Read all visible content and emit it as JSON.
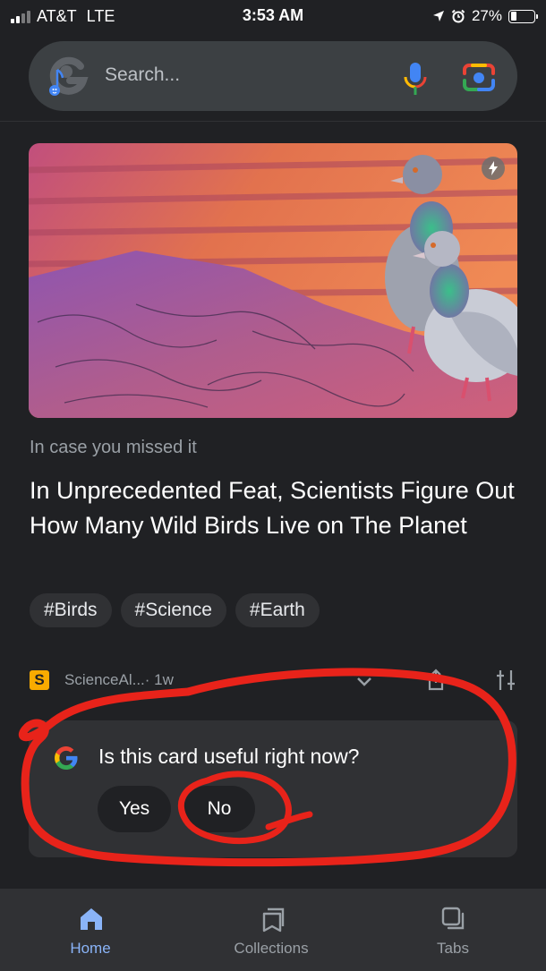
{
  "status_bar": {
    "carrier": "AT&T",
    "network": "LTE",
    "time": "3:53 AM",
    "battery": "27%",
    "battery_level": 0.27
  },
  "search": {
    "placeholder": "Search..."
  },
  "card": {
    "kicker": "In case you missed it",
    "headline": "In Unprecedented Feat, Scientists Figure Out How Many Wild Birds Live on The Planet",
    "tags": [
      "#Birds",
      "#Science",
      "#Earth"
    ],
    "source_logo": "S",
    "source_name": "ScienceAl...· 1w"
  },
  "feedback": {
    "question": "Is this card useful right now?",
    "yes_label": "Yes",
    "no_label": "No"
  },
  "nav": {
    "items": [
      {
        "label": "Home",
        "icon": "home-icon",
        "active": true
      },
      {
        "label": "Collections",
        "icon": "collections-icon",
        "active": false
      },
      {
        "label": "Tabs",
        "icon": "tabs-icon",
        "active": false
      }
    ]
  },
  "colors": {
    "background": "#202124",
    "surface": "#303134",
    "accent": "#8ab4f8",
    "annotation": "#e8231a"
  }
}
